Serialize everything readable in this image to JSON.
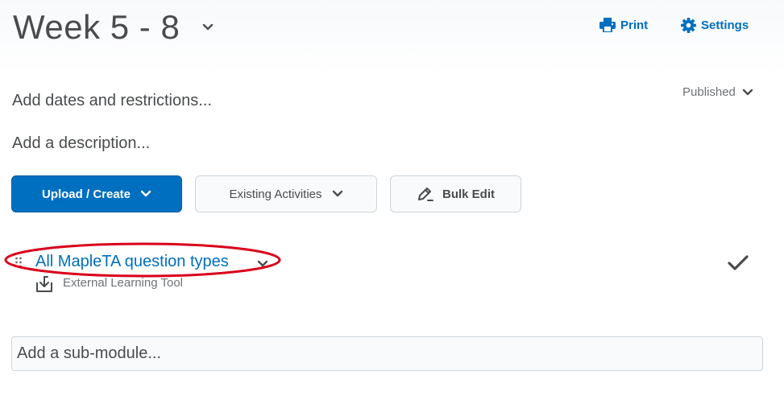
{
  "header": {
    "title": "Week 5 - 8",
    "print_label": "Print",
    "settings_label": "Settings"
  },
  "module": {
    "status": "Published",
    "dates_link": "Add dates and restrictions...",
    "description_link": "Add a description..."
  },
  "actions": {
    "upload_create_label": "Upload / Create",
    "existing_activities_label": "Existing Activities",
    "bulk_edit_label": "Bulk Edit"
  },
  "topic": {
    "title": "All MapleTA question types",
    "type_label": "External Learning Tool",
    "annotation_color": "#d9001b"
  },
  "submodule": {
    "placeholder": "Add a sub-module..."
  },
  "colors": {
    "accent": "#006fbf",
    "text": "#494c4e",
    "muted": "#6e7376",
    "border": "#cdd5dc"
  },
  "icons": [
    "chevron-down-icon",
    "printer-icon",
    "gear-icon",
    "pencil-icon",
    "drag-handle-icon",
    "external-tool-icon",
    "checkmark-icon"
  ]
}
